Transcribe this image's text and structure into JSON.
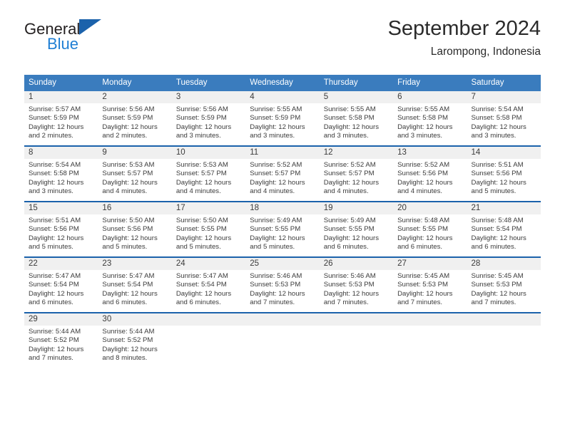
{
  "logo": {
    "line1": "General",
    "line2": "Blue",
    "triangle_color": "#1b62ab",
    "blue_text_color": "#1f7fd4"
  },
  "header": {
    "title": "September 2024",
    "subtitle": "Larompong, Indonesia"
  },
  "colors": {
    "header_blue": "#3a7cbe",
    "rule_blue": "#1b62ab",
    "daynum_band": "#f0f0f0",
    "text": "#3b3b3b"
  },
  "weekday_headers": [
    "Sunday",
    "Monday",
    "Tuesday",
    "Wednesday",
    "Thursday",
    "Friday",
    "Saturday"
  ],
  "weeks": [
    [
      {
        "day": "1",
        "sunrise": "Sunrise: 5:57 AM",
        "sunset": "Sunset: 5:59 PM",
        "daylight": "Daylight: 12 hours and 2 minutes."
      },
      {
        "day": "2",
        "sunrise": "Sunrise: 5:56 AM",
        "sunset": "Sunset: 5:59 PM",
        "daylight": "Daylight: 12 hours and 2 minutes."
      },
      {
        "day": "3",
        "sunrise": "Sunrise: 5:56 AM",
        "sunset": "Sunset: 5:59 PM",
        "daylight": "Daylight: 12 hours and 3 minutes."
      },
      {
        "day": "4",
        "sunrise": "Sunrise: 5:55 AM",
        "sunset": "Sunset: 5:59 PM",
        "daylight": "Daylight: 12 hours and 3 minutes."
      },
      {
        "day": "5",
        "sunrise": "Sunrise: 5:55 AM",
        "sunset": "Sunset: 5:58 PM",
        "daylight": "Daylight: 12 hours and 3 minutes."
      },
      {
        "day": "6",
        "sunrise": "Sunrise: 5:55 AM",
        "sunset": "Sunset: 5:58 PM",
        "daylight": "Daylight: 12 hours and 3 minutes."
      },
      {
        "day": "7",
        "sunrise": "Sunrise: 5:54 AM",
        "sunset": "Sunset: 5:58 PM",
        "daylight": "Daylight: 12 hours and 3 minutes."
      }
    ],
    [
      {
        "day": "8",
        "sunrise": "Sunrise: 5:54 AM",
        "sunset": "Sunset: 5:58 PM",
        "daylight": "Daylight: 12 hours and 3 minutes."
      },
      {
        "day": "9",
        "sunrise": "Sunrise: 5:53 AM",
        "sunset": "Sunset: 5:57 PM",
        "daylight": "Daylight: 12 hours and 4 minutes."
      },
      {
        "day": "10",
        "sunrise": "Sunrise: 5:53 AM",
        "sunset": "Sunset: 5:57 PM",
        "daylight": "Daylight: 12 hours and 4 minutes."
      },
      {
        "day": "11",
        "sunrise": "Sunrise: 5:52 AM",
        "sunset": "Sunset: 5:57 PM",
        "daylight": "Daylight: 12 hours and 4 minutes."
      },
      {
        "day": "12",
        "sunrise": "Sunrise: 5:52 AM",
        "sunset": "Sunset: 5:57 PM",
        "daylight": "Daylight: 12 hours and 4 minutes."
      },
      {
        "day": "13",
        "sunrise": "Sunrise: 5:52 AM",
        "sunset": "Sunset: 5:56 PM",
        "daylight": "Daylight: 12 hours and 4 minutes."
      },
      {
        "day": "14",
        "sunrise": "Sunrise: 5:51 AM",
        "sunset": "Sunset: 5:56 PM",
        "daylight": "Daylight: 12 hours and 5 minutes."
      }
    ],
    [
      {
        "day": "15",
        "sunrise": "Sunrise: 5:51 AM",
        "sunset": "Sunset: 5:56 PM",
        "daylight": "Daylight: 12 hours and 5 minutes."
      },
      {
        "day": "16",
        "sunrise": "Sunrise: 5:50 AM",
        "sunset": "Sunset: 5:56 PM",
        "daylight": "Daylight: 12 hours and 5 minutes."
      },
      {
        "day": "17",
        "sunrise": "Sunrise: 5:50 AM",
        "sunset": "Sunset: 5:55 PM",
        "daylight": "Daylight: 12 hours and 5 minutes."
      },
      {
        "day": "18",
        "sunrise": "Sunrise: 5:49 AM",
        "sunset": "Sunset: 5:55 PM",
        "daylight": "Daylight: 12 hours and 5 minutes."
      },
      {
        "day": "19",
        "sunrise": "Sunrise: 5:49 AM",
        "sunset": "Sunset: 5:55 PM",
        "daylight": "Daylight: 12 hours and 6 minutes."
      },
      {
        "day": "20",
        "sunrise": "Sunrise: 5:48 AM",
        "sunset": "Sunset: 5:55 PM",
        "daylight": "Daylight: 12 hours and 6 minutes."
      },
      {
        "day": "21",
        "sunrise": "Sunrise: 5:48 AM",
        "sunset": "Sunset: 5:54 PM",
        "daylight": "Daylight: 12 hours and 6 minutes."
      }
    ],
    [
      {
        "day": "22",
        "sunrise": "Sunrise: 5:47 AM",
        "sunset": "Sunset: 5:54 PM",
        "daylight": "Daylight: 12 hours and 6 minutes."
      },
      {
        "day": "23",
        "sunrise": "Sunrise: 5:47 AM",
        "sunset": "Sunset: 5:54 PM",
        "daylight": "Daylight: 12 hours and 6 minutes."
      },
      {
        "day": "24",
        "sunrise": "Sunrise: 5:47 AM",
        "sunset": "Sunset: 5:54 PM",
        "daylight": "Daylight: 12 hours and 6 minutes."
      },
      {
        "day": "25",
        "sunrise": "Sunrise: 5:46 AM",
        "sunset": "Sunset: 5:53 PM",
        "daylight": "Daylight: 12 hours and 7 minutes."
      },
      {
        "day": "26",
        "sunrise": "Sunrise: 5:46 AM",
        "sunset": "Sunset: 5:53 PM",
        "daylight": "Daylight: 12 hours and 7 minutes."
      },
      {
        "day": "27",
        "sunrise": "Sunrise: 5:45 AM",
        "sunset": "Sunset: 5:53 PM",
        "daylight": "Daylight: 12 hours and 7 minutes."
      },
      {
        "day": "28",
        "sunrise": "Sunrise: 5:45 AM",
        "sunset": "Sunset: 5:53 PM",
        "daylight": "Daylight: 12 hours and 7 minutes."
      }
    ],
    [
      {
        "day": "29",
        "sunrise": "Sunrise: 5:44 AM",
        "sunset": "Sunset: 5:52 PM",
        "daylight": "Daylight: 12 hours and 7 minutes."
      },
      {
        "day": "30",
        "sunrise": "Sunrise: 5:44 AM",
        "sunset": "Sunset: 5:52 PM",
        "daylight": "Daylight: 12 hours and 8 minutes."
      },
      {
        "day": "",
        "sunrise": "",
        "sunset": "",
        "daylight": ""
      },
      {
        "day": "",
        "sunrise": "",
        "sunset": "",
        "daylight": ""
      },
      {
        "day": "",
        "sunrise": "",
        "sunset": "",
        "daylight": ""
      },
      {
        "day": "",
        "sunrise": "",
        "sunset": "",
        "daylight": ""
      },
      {
        "day": "",
        "sunrise": "",
        "sunset": "",
        "daylight": ""
      }
    ]
  ]
}
